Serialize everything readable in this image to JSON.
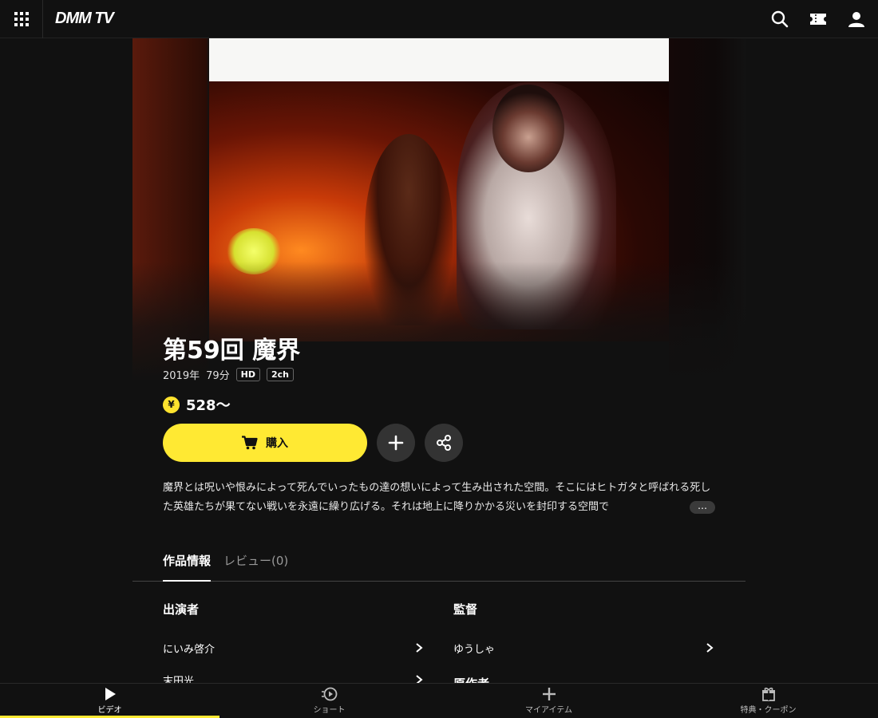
{
  "header": {
    "logo": "DMM TV",
    "icons": [
      "grid-menu-icon",
      "search-icon",
      "ticket-icon",
      "user-icon"
    ]
  },
  "video": {
    "title": "第59回 魔界",
    "year": "2019年",
    "duration": "79分",
    "badges": [
      "HD",
      "2ch"
    ],
    "price": "528〜",
    "yen_symbol": "¥",
    "buy_label": "購入",
    "description": "魔界とは呪いや恨みによって死んでいったもの達の想いによって生み出された空間。そこにはヒトガタと呼ばれる死した英雄たちが果てない戦いを永遠に繰り広げる。それは地上に降りかかる災いを封印する空間で",
    "more_label": "…"
  },
  "tabs": [
    {
      "label": "作品情報",
      "active": true
    },
    {
      "label": "レビュー(0)",
      "active": false
    }
  ],
  "info": {
    "cast_heading": "出演者",
    "cast": [
      "にいみ啓介",
      "末田光"
    ],
    "director_heading": "監督",
    "directors": [
      "ゆうしゃ"
    ],
    "next_heading": "原作者"
  },
  "bottom_nav": [
    {
      "label": "ビデオ",
      "active": true
    },
    {
      "label": "ショート",
      "active": false
    },
    {
      "label": "マイアイテム",
      "active": false
    },
    {
      "label": "特典・クーポン",
      "active": false
    }
  ],
  "colors": {
    "accent": "#ffe933",
    "background": "#111111",
    "round_button": "#333333"
  }
}
